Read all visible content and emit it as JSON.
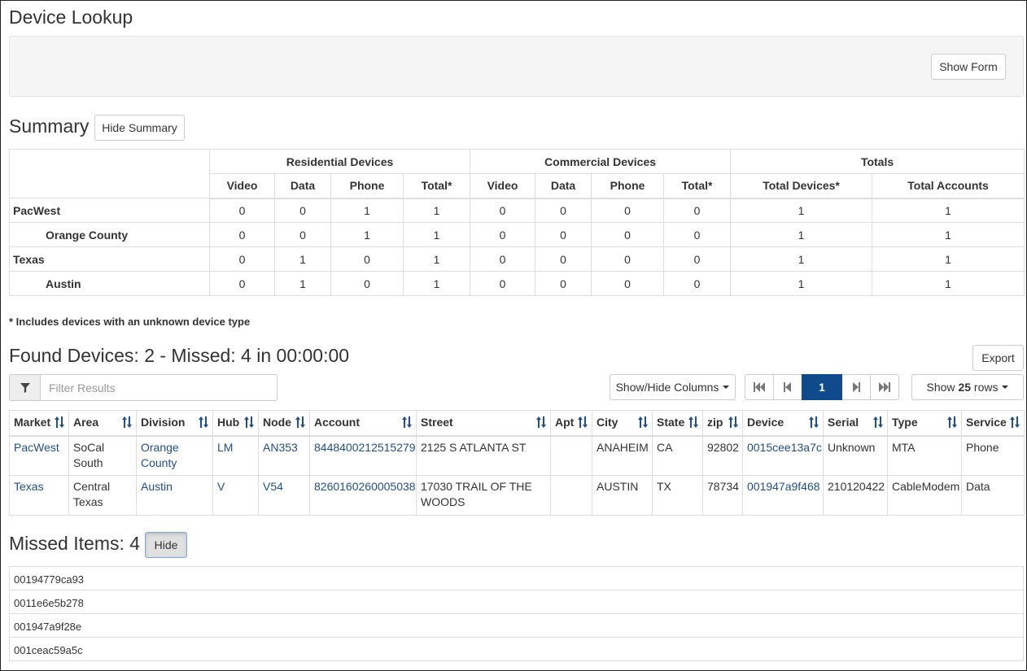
{
  "page": {
    "title": "Device Lookup",
    "show_form_label": "Show Form"
  },
  "summary": {
    "title": "Summary",
    "hide_label": "Hide Summary",
    "groups": [
      "Residential Devices",
      "Commercial Devices",
      "Totals"
    ],
    "columns": [
      "Video",
      "Data",
      "Phone",
      "Total*",
      "Video",
      "Data",
      "Phone",
      "Total*",
      "Total Devices*",
      "Total Accounts"
    ],
    "rows": [
      {
        "label": "PacWest",
        "values": [
          "0",
          "0",
          "1",
          "1",
          "0",
          "0",
          "0",
          "0",
          "1",
          "1"
        ]
      },
      {
        "label": "Orange County",
        "values": [
          "0",
          "0",
          "1",
          "1",
          "0",
          "0",
          "0",
          "0",
          "1",
          "1"
        ]
      },
      {
        "label": "Texas",
        "values": [
          "0",
          "1",
          "0",
          "1",
          "0",
          "0",
          "0",
          "0",
          "1",
          "1"
        ]
      },
      {
        "label": "Austin",
        "values": [
          "0",
          "1",
          "0",
          "1",
          "0",
          "0",
          "0",
          "0",
          "1",
          "1"
        ]
      }
    ],
    "note": "* Includes devices with an unknown device type"
  },
  "found": {
    "title": "Found Devices: 2 - Missed: 4 in 00:00:00",
    "export_label": "Export",
    "filter_placeholder": "Filter Results",
    "show_hide_label": "Show/Hide Columns",
    "current_page": "1",
    "show_prefix": "Show",
    "rows_count": "25",
    "rows_suffix": "rows",
    "columns": [
      "Market",
      "Area",
      "Division",
      "Hub",
      "Node",
      "Account",
      "Street",
      "Apt",
      "City",
      "State",
      "zip",
      "Device",
      "Serial",
      "Type",
      "Service"
    ],
    "rows": [
      {
        "market": "PacWest",
        "area": "SoCal South",
        "division": "Orange County",
        "hub": "LM",
        "node": "AN353",
        "account": "8448400212515279",
        "street": "2125 S ATLANTA ST",
        "apt": "",
        "city": "ANAHEIM",
        "state": "CA",
        "zip": "92802",
        "device": "0015cee13a7c",
        "serial": "Unknown",
        "type": "MTA",
        "service": "Phone"
      },
      {
        "market": "Texas",
        "area": "Central Texas",
        "division": "Austin",
        "hub": "V",
        "node": "V54",
        "account": "8260160260005038",
        "street": "17030 TRAIL OF THE WOODS",
        "apt": "",
        "city": "AUSTIN",
        "state": "TX",
        "zip": "78734",
        "device": "001947a9f468",
        "serial": "210120422",
        "type": "CableModem",
        "service": "Data"
      }
    ]
  },
  "missed": {
    "title": "Missed Items: 4",
    "hide_label": "Hide",
    "items": [
      "00194779ca93",
      "0011e6e5b278",
      "001947a9f28e",
      "001ceac59a5c"
    ]
  },
  "colors": {
    "link": "#1f4e8c",
    "pager_active": "#0f4a8c",
    "border": "#dddddd",
    "well": "#f5f5f5"
  },
  "icons": {
    "filter": "filter-icon",
    "sort": "sort-icon",
    "first": "first-page-icon",
    "prev": "prev-page-icon",
    "next": "next-page-icon",
    "last": "last-page-icon"
  }
}
